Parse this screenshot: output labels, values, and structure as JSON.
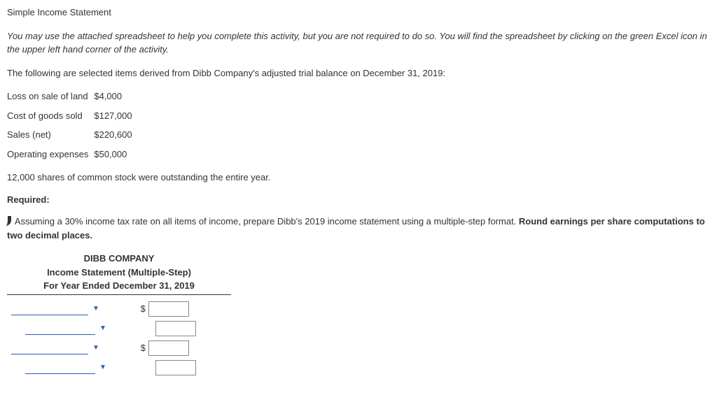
{
  "title": "Simple Income Statement",
  "instructions": "You may use the attached spreadsheet to help you complete this activity, but you are not required to do so. You will find the spreadsheet by clicking on the green Excel icon in the upper left hand corner of the activity.",
  "intro": "The following are selected items derived from Dibb Company's adjusted trial balance on December 31, 2019:",
  "trial_balance": [
    {
      "label": "Loss on sale of land",
      "amount": "$4,000"
    },
    {
      "label": "Cost of goods sold",
      "amount": "$127,000"
    },
    {
      "label": "Sales (net)",
      "amount": "$220,600"
    },
    {
      "label": "Operating expenses",
      "amount": "$50,000"
    }
  ],
  "shares_note": "12,000 shares of common stock were outstanding the entire year.",
  "required_label": "Required:",
  "requirement_text": "Assuming a 30% income tax rate on all items of income, prepare Dibb's 2019 income statement using a multiple-step format. ",
  "requirement_bold": "Round earnings per share computations to two decimal places.",
  "statement": {
    "company": "DIBB COMPANY",
    "title": "Income Statement (Multiple-Step)",
    "period": "For Year Ended December 31, 2019"
  },
  "rows": [
    {
      "indent": "long",
      "dropdown": true,
      "dollar": "$",
      "show_dollar": true
    },
    {
      "indent": "short",
      "dropdown": true,
      "dollar": "$",
      "show_dollar": false
    },
    {
      "indent": "long",
      "dropdown": true,
      "dollar": "$",
      "show_dollar": true
    },
    {
      "indent": "short",
      "dropdown": true,
      "dollar": "$",
      "show_dollar": false
    }
  ],
  "currency_symbol": "$"
}
